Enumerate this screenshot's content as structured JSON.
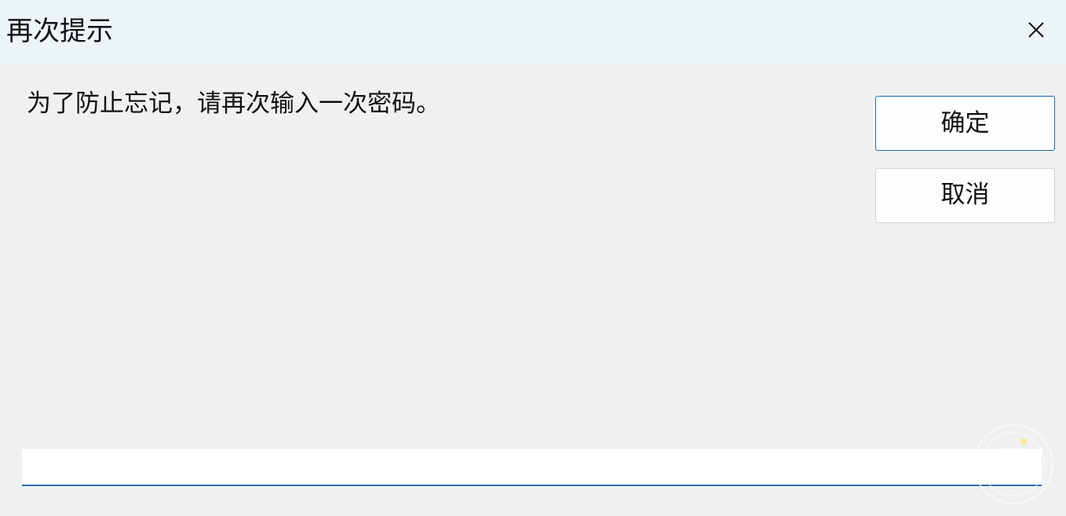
{
  "dialog": {
    "title": "再次提示",
    "prompt": "为了防止忘记，请再次输入一次密码。",
    "confirm_label": "确定",
    "cancel_label": "取消",
    "input_value": "",
    "accent_color": "#1b6fb5",
    "close_icon": "close-icon"
  }
}
